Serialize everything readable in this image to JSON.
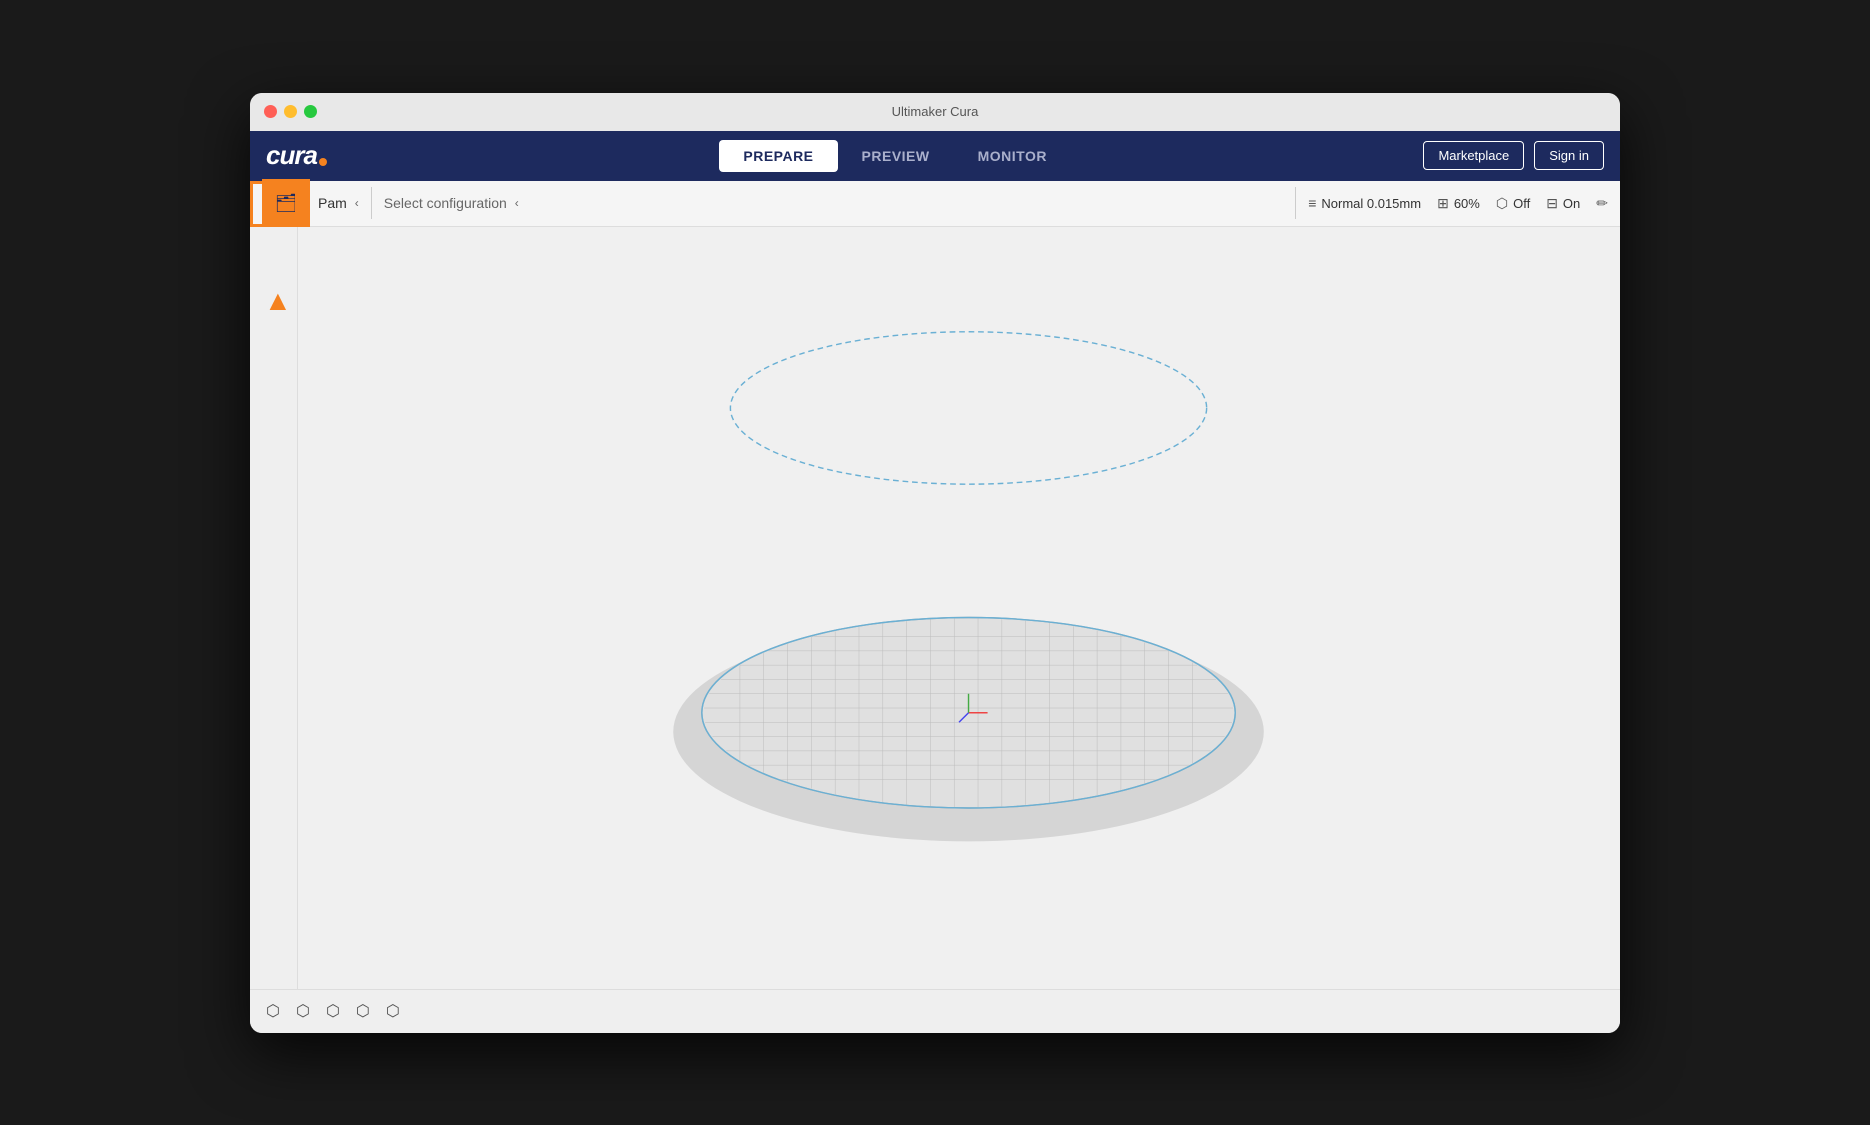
{
  "window": {
    "title": "Ultimaker Cura"
  },
  "controls": {
    "close": "close",
    "minimize": "minimize",
    "maximize": "maximize"
  },
  "logo": {
    "text": "cura",
    "dot": "•"
  },
  "nav": {
    "tabs": [
      {
        "id": "prepare",
        "label": "PREPARE",
        "active": true
      },
      {
        "id": "preview",
        "label": "PREVIEW",
        "active": false
      },
      {
        "id": "monitor",
        "label": "MONITOR",
        "active": false
      }
    ],
    "marketplace_label": "Marketplace",
    "signin_label": "Sign in"
  },
  "toolbar": {
    "printer_name": "Pam",
    "config_placeholder": "Select configuration",
    "quality_label": "Normal 0.015mm",
    "infill_label": "60%",
    "support_label": "Off",
    "adhesion_label": "On"
  },
  "bottom_tools": {
    "tools": [
      "⬡",
      "⬡",
      "⬡",
      "⬡",
      "⬡"
    ]
  },
  "viewport": {
    "bg_color": "#f0f0f0",
    "grid_color": "#cccccc",
    "model_color": "#c8c8c8",
    "outline_color": "#6ab0d4",
    "plate_color": "#d8d8d8"
  }
}
